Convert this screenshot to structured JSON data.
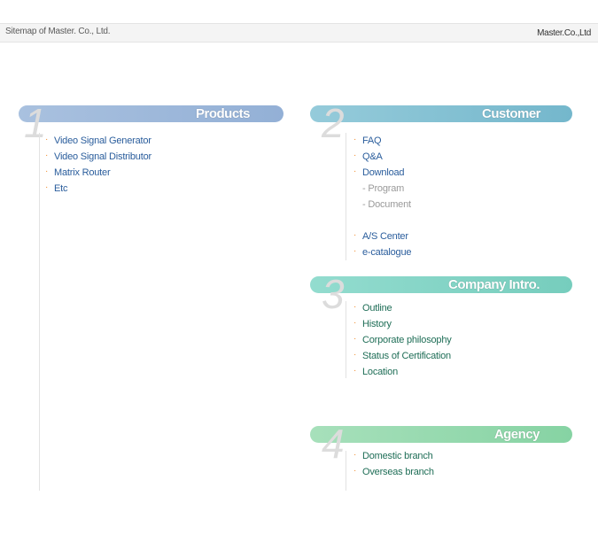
{
  "header": {
    "title": "Sitemap of Master. Co., Ltd.",
    "company": "Master.Co.,Ltd"
  },
  "colors": {
    "products_pill": "#9fb9da",
    "customer_pill": "#83c2d4",
    "company_pill": "#84d5c7",
    "agency_pill": "#9adab0",
    "link_blue": "#2a5d9c",
    "link_green": "#1f6e57",
    "bullet": "#f08a2a"
  },
  "sections": {
    "products": {
      "number": "1",
      "title": "Products",
      "items": [
        "Video Signal Generator",
        "Video Signal Distributor",
        "Matrix Router",
        "Etc"
      ]
    },
    "customer": {
      "number": "2",
      "title": "Customer",
      "items": [
        "FAQ",
        "Q&A",
        "Download"
      ],
      "subitems": [
        "- Program",
        "- Document"
      ],
      "items2": [
        "A/S Center",
        "e-catalogue"
      ]
    },
    "company": {
      "number": "3",
      "title": "Company Intro.",
      "items": [
        "Outline",
        "History",
        "Corporate philosophy",
        "Status of Certification",
        "Location"
      ]
    },
    "agency": {
      "number": "4",
      "title": "Agency",
      "items": [
        "Domestic branch",
        "Overseas branch"
      ]
    }
  }
}
